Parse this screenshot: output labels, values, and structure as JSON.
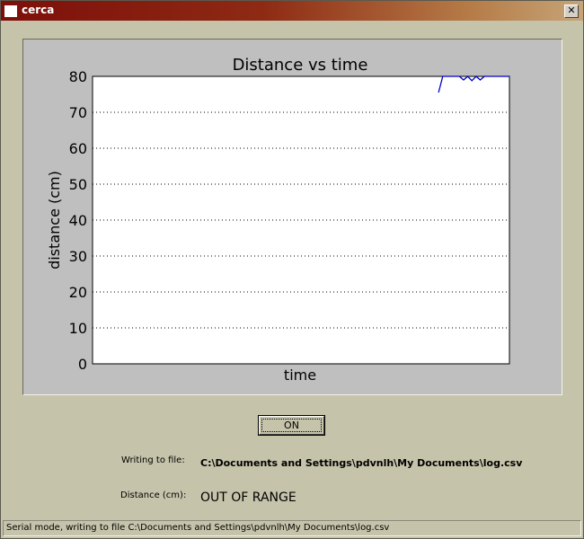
{
  "window": {
    "title": "cerca",
    "close_label": "✕"
  },
  "controls": {
    "toggle_label": "ON",
    "file_label": "Writing to file:",
    "file_path": "C:\\Documents and Settings\\pdvnlh\\My Documents\\log.csv",
    "distance_label": "Distance (cm):",
    "distance_value": "OUT OF RANGE"
  },
  "status_bar": {
    "text": "Serial mode, writing to file C:\\Documents and Settings\\pdvnlh\\My Documents\\log.csv"
  },
  "colors": {
    "line": "#0000cc",
    "plot_bg": "#ffffff",
    "panel_bg": "#bfbfbf"
  },
  "chart_data": {
    "type": "line",
    "title": "Distance vs time",
    "xlabel": "time",
    "ylabel": "distance (cm)",
    "ylim": [
      0,
      80
    ],
    "yticks": [
      "0",
      "10",
      "20",
      "30",
      "40",
      "50",
      "60",
      "70",
      "80"
    ],
    "xlim": [
      0,
      100
    ],
    "grid": "y-dotted",
    "series": [
      {
        "x": [
          83,
          84,
          85,
          86,
          87,
          88,
          89,
          90,
          91,
          92,
          93,
          94,
          95,
          96,
          97,
          98,
          99,
          100
        ],
        "y": [
          75.5,
          80,
          80,
          80,
          80,
          80,
          79,
          80,
          78.8,
          80,
          79,
          80,
          80,
          80,
          80,
          80,
          80,
          80
        ]
      }
    ]
  }
}
